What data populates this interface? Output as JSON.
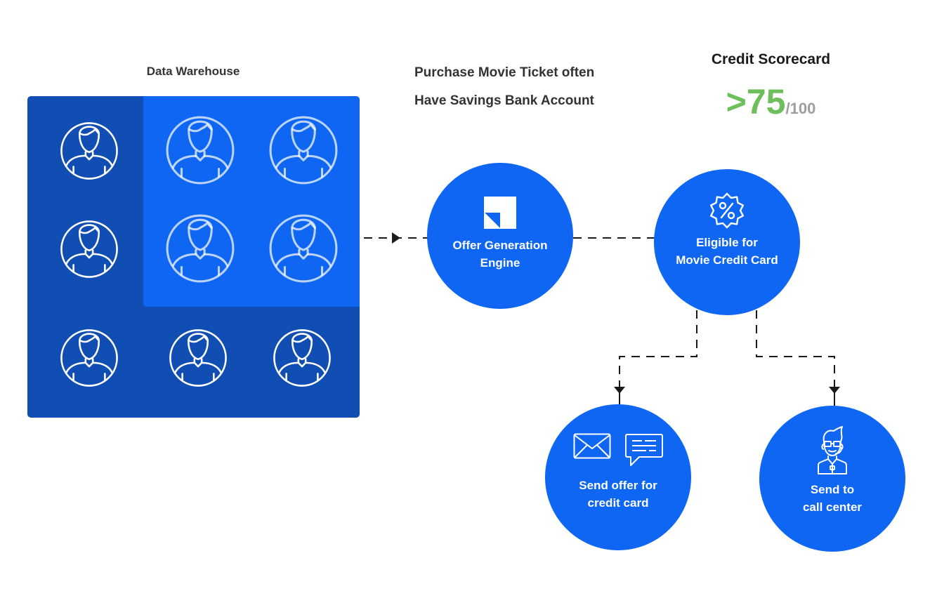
{
  "warehouse": {
    "title": "Data Warehouse",
    "users_total": 9,
    "users_segmented": 4
  },
  "conditions": [
    "Purchase Movie Ticket often",
    "Have Savings Bank Account"
  ],
  "scorecard": {
    "title": "Credit Scorecard",
    "value": ">75",
    "denominator": "/100"
  },
  "nodes": {
    "engine": {
      "line1": "Offer Generation",
      "line2": "Engine",
      "icon": "engine-logo-icon"
    },
    "eligible": {
      "line1": "Eligible for",
      "line2": "Movie Credit Card",
      "icon": "discount-badge-icon"
    },
    "send_offer": {
      "line1": "Send offer for",
      "line2": "credit card",
      "icons": [
        "envelope-icon",
        "chat-message-icon"
      ]
    },
    "call_center": {
      "line1": "Send to",
      "line2": "call center",
      "icon": "call-center-agent-icon"
    }
  },
  "colors": {
    "warehouse_dark": "#104eb4",
    "segment_blue": "#0e66f3",
    "node_blue": "#0e66f3",
    "score_green": "#6cbf5a",
    "score_gray": "#9e9e9e",
    "text_dark": "#333333",
    "connector": "#1a1a1a"
  }
}
